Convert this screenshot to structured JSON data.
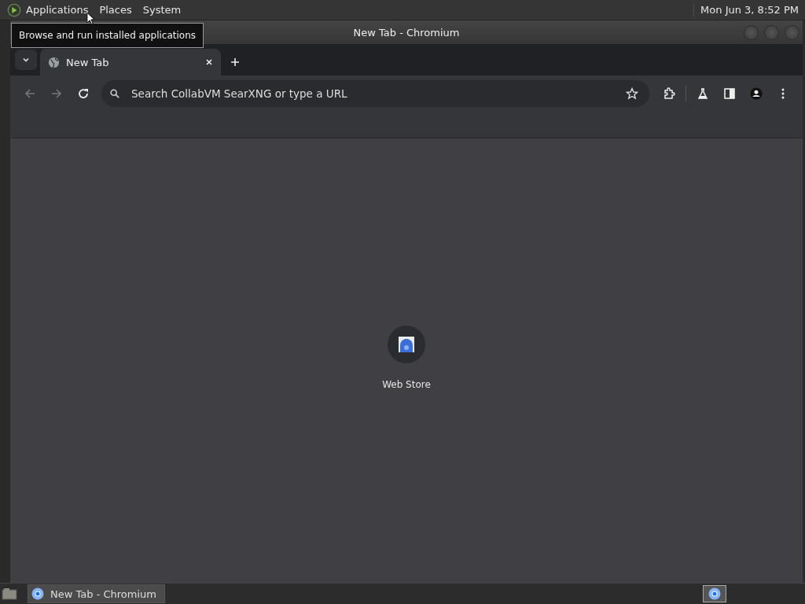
{
  "top_panel": {
    "menus": [
      "Applications",
      "Places",
      "System"
    ],
    "clock": "Mon Jun 3, 8:52 PM"
  },
  "tooltip": "Browse and run installed applications",
  "window": {
    "title": "New Tab - Chromium"
  },
  "tabs": [
    {
      "label": "New Tab",
      "selected": true
    }
  ],
  "omnibox": {
    "placeholder": "Search CollabVM SearXNG or type a URL"
  },
  "shortcuts": [
    {
      "label": "Web Store"
    }
  ],
  "taskbar": {
    "items": [
      {
        "label": "New Tab - Chromium",
        "selected": true
      }
    ]
  }
}
